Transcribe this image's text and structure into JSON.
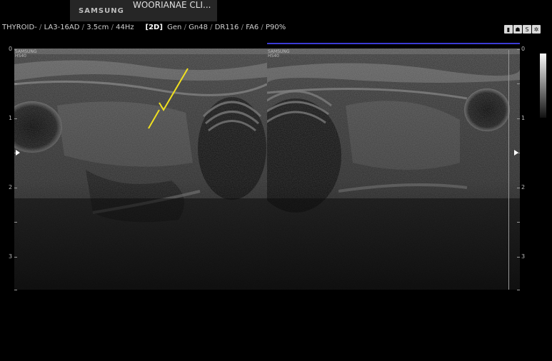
{
  "brand": {
    "logo": "SAMSUNG",
    "clinic": "WOORIANAE CLI..."
  },
  "params": {
    "preset": "THYROID-",
    "probe": "LA3-16AD",
    "depth": "3.5cm",
    "frame_rate": "44Hz",
    "mode": "[2D]",
    "gen": "Gen",
    "gain": "Gn48",
    "dynamic_range": "DR116",
    "frame_avg": "FA6",
    "power": "P90%"
  },
  "images": {
    "left_label": "SAMSUNG\nHS40",
    "right_label": "SAMSUNG\nHS40"
  },
  "depth_scale": {
    "labels": [
      "0",
      "1",
      "2",
      "3"
    ]
  },
  "colors": {
    "background": "#000000",
    "annotation": "#f0e020",
    "top_line": "#3b3bd6"
  },
  "icons": [
    "probe-icon",
    "body-icon",
    "s-icon",
    "gear-icon"
  ]
}
